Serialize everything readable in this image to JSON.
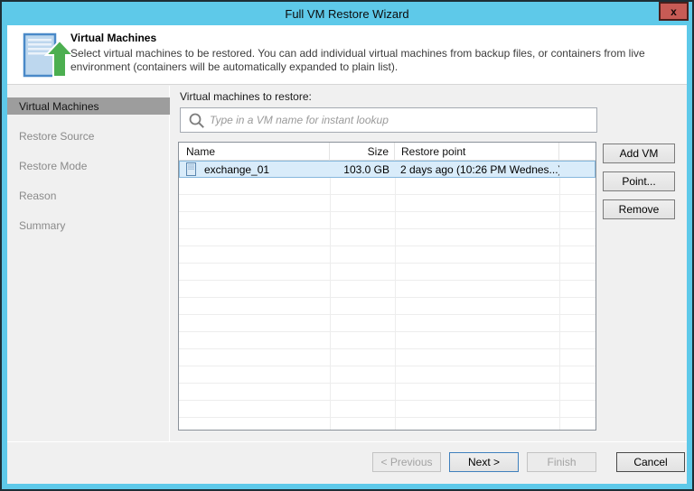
{
  "window": {
    "title": "Full VM Restore Wizard",
    "close_label": "x"
  },
  "header": {
    "title": "Virtual Machines",
    "description": "Select virtual machines to be restored. You  can add individual virtual machines from backup files, or containers from live environment (containers will be automatically expanded to plain list)."
  },
  "sidebar": {
    "items": [
      {
        "label": "Virtual Machines",
        "active": true
      },
      {
        "label": "Restore Source",
        "active": false
      },
      {
        "label": "Restore Mode",
        "active": false
      },
      {
        "label": "Reason",
        "active": false
      },
      {
        "label": "Summary",
        "active": false
      }
    ]
  },
  "content": {
    "list_label": "Virtual machines to restore:",
    "search": {
      "placeholder": "Type in a VM name for instant lookup",
      "icon": "search-icon"
    },
    "table": {
      "columns": [
        "Name",
        "Size",
        "Restore point"
      ],
      "rows": [
        {
          "name": "exchange_01",
          "size": "103.0 GB",
          "restore_point": "2 days ago (10:26 PM Wednes...)",
          "selected": true,
          "icon": "vm-icon"
        }
      ]
    },
    "side_buttons": [
      {
        "label": "Add VM"
      },
      {
        "label": "Point..."
      },
      {
        "label": "Remove"
      }
    ]
  },
  "footer": {
    "buttons": [
      {
        "label": "< Previous",
        "state": "disabled"
      },
      {
        "label": "Next >",
        "state": "focused"
      },
      {
        "label": "Finish",
        "state": "disabled"
      },
      {
        "label": "Cancel",
        "state": "enabled"
      }
    ]
  },
  "colors": {
    "frame_blue": "#5ec9e9",
    "frame_dark": "#1d2e36",
    "close_red": "#c75b55",
    "content_bg": "#f0f0f0",
    "active_nav_bg": "#9d9d9d",
    "selected_row_bg": "#d9ecfa",
    "selected_row_border": "#86b8dd",
    "focus_button_border": "#3f80bd",
    "arrow_green": "#4caf50",
    "vm_icon_blue": "#bdd7ee"
  }
}
